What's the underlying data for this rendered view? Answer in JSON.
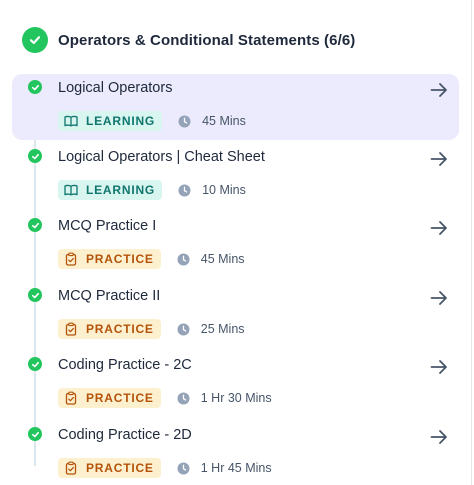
{
  "section": {
    "title": "Operators & Conditional Statements (6/6)"
  },
  "colors": {
    "complete": "#22c55e",
    "active_row": "#ecebfd",
    "learning_bg": "#d8f5ef",
    "practice_bg": "#fdf0cf"
  },
  "lessons": [
    {
      "title": "Logical Operators",
      "type": "LEARNING",
      "icon": "book-icon",
      "duration": "45 Mins",
      "active": true
    },
    {
      "title": "Logical Operators | Cheat Sheet",
      "type": "LEARNING",
      "icon": "book-icon",
      "duration": "10 Mins",
      "active": false
    },
    {
      "title": "MCQ Practice I",
      "type": "PRACTICE",
      "icon": "clipboard-check-icon",
      "duration": "45 Mins",
      "active": false
    },
    {
      "title": "MCQ Practice II",
      "type": "PRACTICE",
      "icon": "clipboard-check-icon",
      "duration": "25 Mins",
      "active": false
    },
    {
      "title": "Coding Practice - 2C",
      "type": "PRACTICE",
      "icon": "clipboard-check-icon",
      "duration": "1 Hr 30 Mins",
      "active": false
    },
    {
      "title": "Coding Practice - 2D",
      "type": "PRACTICE",
      "icon": "clipboard-check-icon",
      "duration": "1 Hr 45 Mins",
      "active": false
    }
  ]
}
